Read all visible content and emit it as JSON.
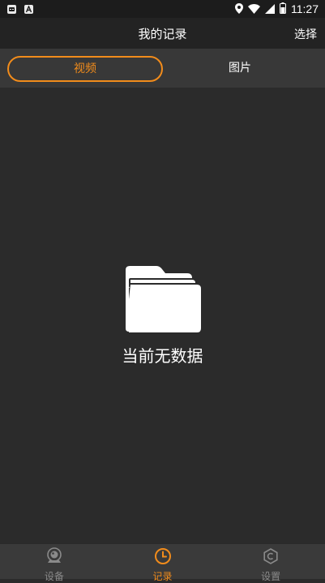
{
  "status_bar": {
    "time": "11:27",
    "left_icons": [
      "notification-icon",
      "a-icon"
    ],
    "right_icons": [
      "location-icon",
      "wifi-icon",
      "signal-icon",
      "battery-icon"
    ]
  },
  "header": {
    "title": "我的记录",
    "select_label": "选择"
  },
  "tabs": [
    {
      "label": "视频",
      "active": true
    },
    {
      "label": "图片",
      "active": false
    }
  ],
  "empty_state": {
    "icon": "folder-icon",
    "text": "当前无数据"
  },
  "bottom_nav": [
    {
      "label": "设备",
      "icon": "camera-icon",
      "active": false
    },
    {
      "label": "记录",
      "icon": "clock-icon",
      "active": true
    },
    {
      "label": "设置",
      "icon": "settings-icon",
      "active": false
    }
  ],
  "colors": {
    "accent": "#f28c1b",
    "background": "#2b2b2b",
    "inactive_nav": "#8a8a8a"
  }
}
